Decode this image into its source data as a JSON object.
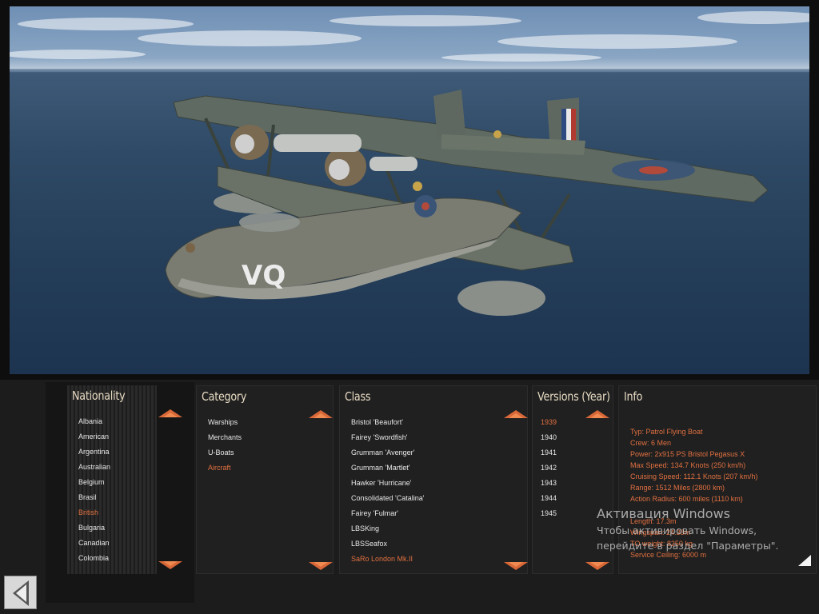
{
  "nationality": {
    "title": "Nationality",
    "items": [
      {
        "label": "Albania",
        "selected": false
      },
      {
        "label": "American",
        "selected": false
      },
      {
        "label": "Argentina",
        "selected": false
      },
      {
        "label": "Australian",
        "selected": false
      },
      {
        "label": "Belgium",
        "selected": false
      },
      {
        "label": "Brasil",
        "selected": false
      },
      {
        "label": "British",
        "selected": true
      },
      {
        "label": "Bulgaria",
        "selected": false
      },
      {
        "label": "Canadian",
        "selected": false
      },
      {
        "label": "Colombia",
        "selected": false
      }
    ]
  },
  "category": {
    "title": "Category",
    "items": [
      {
        "label": "Warships",
        "selected": false
      },
      {
        "label": "Merchants",
        "selected": false
      },
      {
        "label": "U-Boats",
        "selected": false
      },
      {
        "label": "Aircraft",
        "selected": true
      }
    ]
  },
  "class": {
    "title": "Class",
    "items": [
      {
        "label": "Bristol  'Beaufort'",
        "selected": false
      },
      {
        "label": "Fairey  'Swordfish'",
        "selected": false
      },
      {
        "label": "Grumman  'Avenger'",
        "selected": false
      },
      {
        "label": "Grumman  'Martlet'",
        "selected": false
      },
      {
        "label": "Hawker  'Hurricane'",
        "selected": false
      },
      {
        "label": "Consolidated  'Catalina'",
        "selected": false
      },
      {
        "label": "Fairey  'Fulmar'",
        "selected": false
      },
      {
        "label": "LBSKing",
        "selected": false
      },
      {
        "label": "LBSSeafox",
        "selected": false
      },
      {
        "label": "SaRo  London  Mk.II",
        "selected": true
      }
    ]
  },
  "versions": {
    "title": "Versions (Year)",
    "items": [
      {
        "label": "1939",
        "selected": true
      },
      {
        "label": "1940",
        "selected": false
      },
      {
        "label": "1941",
        "selected": false
      },
      {
        "label": "1942",
        "selected": false
      },
      {
        "label": "1943",
        "selected": false
      },
      {
        "label": "1944",
        "selected": false
      },
      {
        "label": "1945",
        "selected": false
      }
    ]
  },
  "info": {
    "title": "Info",
    "lines": [
      "Typ: Patrol Flying Boat",
      "Crew: 6 Men",
      "Power: 2x915 PS Bristol Pegasus X",
      "Max Speed: 134.7 Knots (250 km/h)",
      "Cruising Speed: 112.1 Knots (207 km/h)",
      "Range: 1512 Miles (2800 km)",
      "Action Radius: 600 miles (1110 km)",
      "",
      "Length: 17.3m",
      "Wingspan: 24.38m",
      "TO weight: 8250 kg",
      "Service Ceiling: 6000 m"
    ]
  },
  "watermark": {
    "line1": "Активация Windows",
    "line2": "Чтобы активировать Windows,",
    "line3": "перейдите в раздел \"Параметры\"."
  },
  "aircraft_markings": {
    "fuselage_code": "VQ"
  },
  "colors": {
    "accent": "#e07040",
    "text": "#e6e6e6",
    "title": "#e7dbc3",
    "panel": "#202020"
  },
  "icons": {
    "scroll_up": "triangle-up-icon",
    "scroll_down": "triangle-down-icon",
    "back": "arrow-left-icon",
    "corner": "resize-corner-icon"
  }
}
